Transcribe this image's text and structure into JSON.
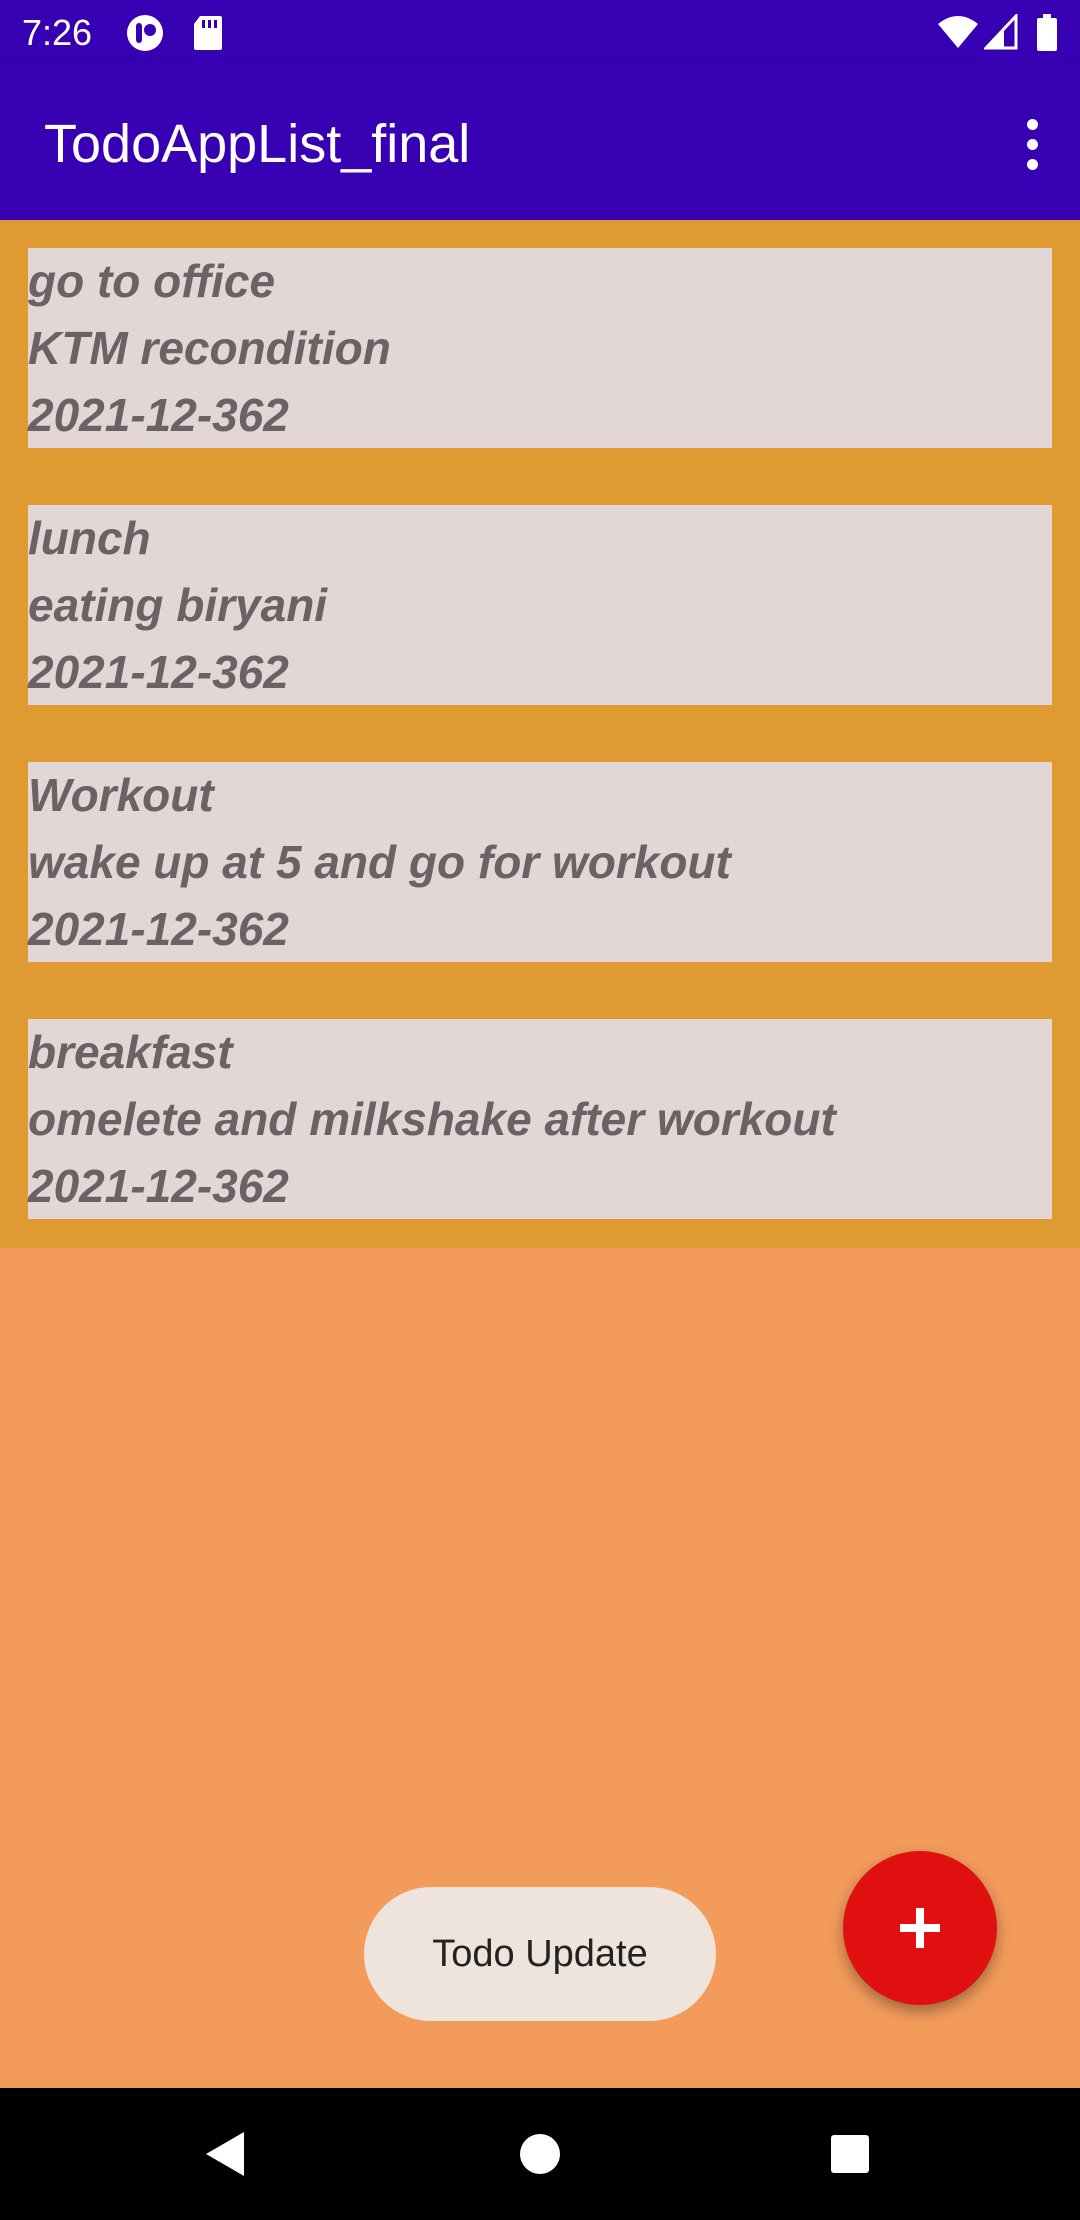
{
  "status_bar": {
    "time": "7:26",
    "icons": [
      "notification-icon",
      "sd-card-icon",
      "wifi-icon",
      "signal-icon",
      "battery-icon"
    ]
  },
  "app_bar": {
    "title": "TodoAppList_final",
    "menu_icon": "more-vert-icon"
  },
  "todos": [
    {
      "title": "go to office",
      "description": "KTM recondition",
      "date": "2021-12-362"
    },
    {
      "title": "lunch",
      "description": "eating biryani",
      "date": "2021-12-362"
    },
    {
      "title": "Workout",
      "description": "wake up at 5 and go for workout",
      "date": "2021-12-362"
    },
    {
      "title": "breakfast",
      "description": "omelete and milkshake after workout",
      "date": "2021-12-362"
    }
  ],
  "fab": {
    "icon": "plus-icon"
  },
  "toast": {
    "message": "Todo Update"
  },
  "nav_bar": {
    "icons": [
      "back-icon",
      "home-icon",
      "recents-icon"
    ]
  },
  "colors": {
    "app_bar": "#3700b3",
    "list_background": "#e09a32",
    "card_background": "#e2d6d6",
    "page_background": "#f29b5b",
    "fab": "#e01010",
    "toast_background": "#efe4dc"
  }
}
